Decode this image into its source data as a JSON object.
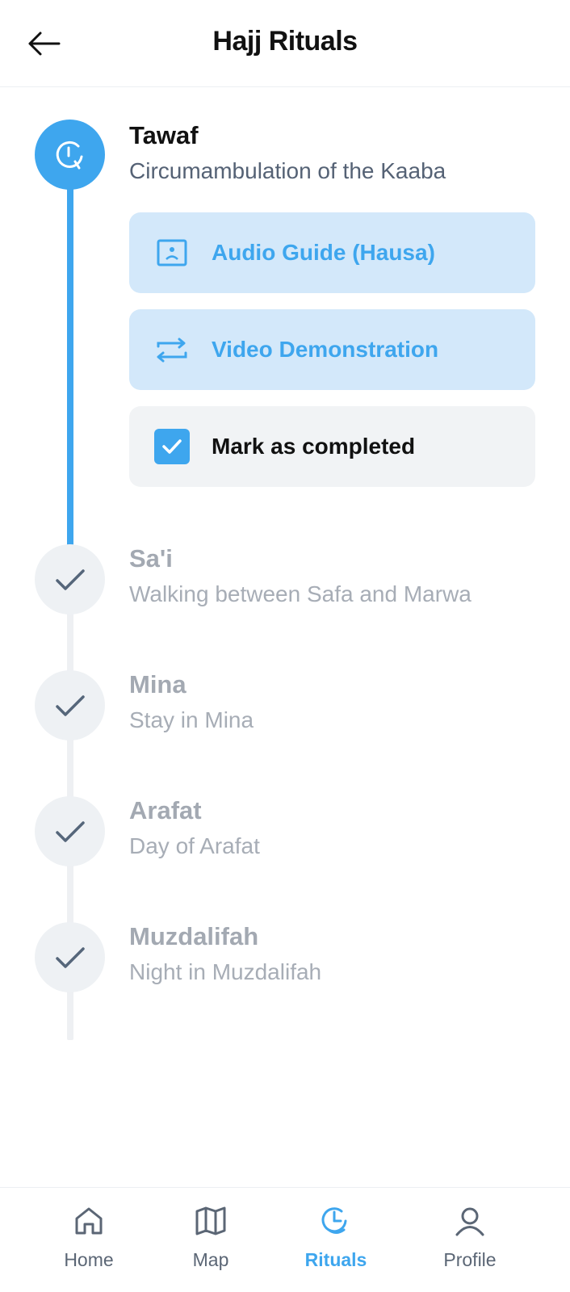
{
  "header": {
    "title": "Hajj Rituals",
    "back_icon": "arrow-left-icon"
  },
  "steps": [
    {
      "title": "Tawaf",
      "subtitle": "Circumambulation of the Kaaba",
      "status": "active",
      "icon": "clock-icon"
    },
    {
      "title": "Sa'i",
      "subtitle": "Walking between Safa and Marwa",
      "status": "completed",
      "icon": "check-icon"
    },
    {
      "title": "Mina",
      "subtitle": "Stay in Mina",
      "status": "completed",
      "icon": "check-icon"
    },
    {
      "title": "Arafat",
      "subtitle": "Day of Arafat",
      "status": "completed",
      "icon": "check-icon"
    },
    {
      "title": "Muzdalifah",
      "subtitle": "Night in Muzdalifah",
      "status": "completed",
      "icon": "check-icon"
    }
  ],
  "actions": {
    "audio_label": "Audio Guide (Hausa)",
    "audio_icon": "audio-guide-icon",
    "video_label": "Video Demonstration",
    "video_icon": "video-icon",
    "complete_label": "Mark as completed",
    "complete_checked": true
  },
  "nav": {
    "items": [
      {
        "label": "Home",
        "icon": "home-icon",
        "active": false
      },
      {
        "label": "Map",
        "icon": "map-icon",
        "active": false
      },
      {
        "label": "Rituals",
        "icon": "rituals-icon",
        "active": true
      },
      {
        "label": "Profile",
        "icon": "profile-icon",
        "active": false
      }
    ]
  },
  "colors": {
    "accent": "#3ea6ee",
    "accent_light": "#d3e8fa",
    "completed_bg": "#eef1f4",
    "muted_text": "#a3a9b2"
  }
}
